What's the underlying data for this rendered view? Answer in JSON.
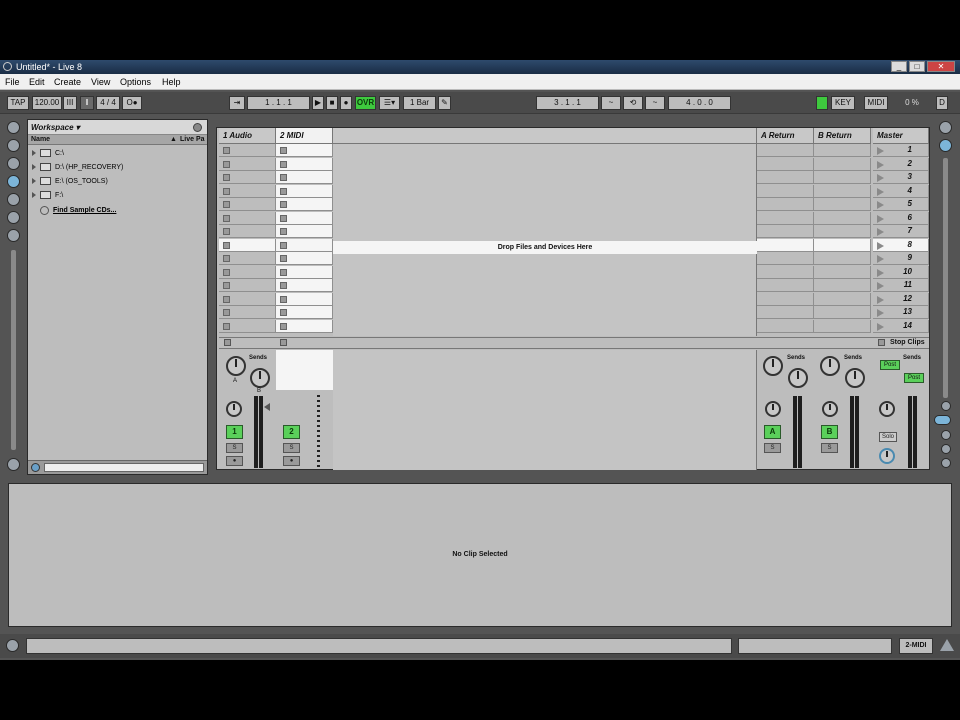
{
  "window": {
    "title": "Untitled* - Live 8",
    "controls": [
      "_",
      "□",
      "✕"
    ]
  },
  "menu": [
    "File",
    "Edit",
    "Create",
    "View",
    "Options",
    "Help"
  ],
  "transport": {
    "tap_label": "TAP",
    "tempo": "120.00",
    "nudge": "III",
    "signature": "4 / 4",
    "metronome": "O●",
    "position": "1 .  1 .  1",
    "ovr_label": "OVR",
    "quantize": "1 Bar",
    "loop_start": "3 .  1 .  1",
    "loop_length": "4 .  0 .  0",
    "key_label": "KEY",
    "midi_label": "MIDI",
    "cpu": "0 %",
    "disk": "D"
  },
  "browser": {
    "location": "Workspace ▾",
    "col_name": "Name",
    "col_live": "Live Pa",
    "items": [
      {
        "label": "C:\\",
        "type": "folder"
      },
      {
        "label": "D:\\ (HP_RECOVERY)",
        "type": "folder"
      },
      {
        "label": "E:\\ (OS_TOOLS)",
        "type": "folder"
      },
      {
        "label": "F:\\",
        "type": "folder"
      },
      {
        "label": "Find Sample CDs...",
        "type": "link"
      }
    ]
  },
  "session": {
    "tracks": [
      "1 Audio",
      "2 MIDI"
    ],
    "returns": [
      "A Return",
      "B Return"
    ],
    "master": "Master",
    "drop_hint": "Drop Files and Devices Here",
    "scenes": [
      "1",
      "2",
      "3",
      "4",
      "5",
      "6",
      "7",
      "8",
      "9",
      "10",
      "11",
      "12",
      "13",
      "14"
    ],
    "stop_clips": "Stop Clips",
    "sends_label": "Sends",
    "send_a": "A",
    "send_b": "B",
    "post_label": "Post",
    "solo_label": "Solo",
    "s_label": "S",
    "rec_label": "●",
    "track_numbers": [
      "1",
      "2"
    ],
    "return_letters": [
      "A",
      "B"
    ]
  },
  "detail": {
    "empty_text": "No Clip Selected"
  },
  "status": {
    "track_name": "2-MIDI"
  }
}
